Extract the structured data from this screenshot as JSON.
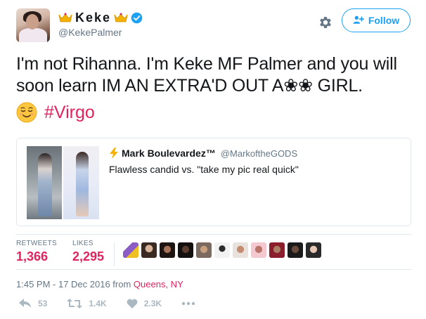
{
  "author": {
    "display_name": "Keke",
    "handle": "@KekePalmer",
    "verified": true,
    "avatar_icon": "profile-photo"
  },
  "follow_button": {
    "label": "Follow",
    "icon": "add-user-icon"
  },
  "settings_icon": "gear-icon",
  "tweet": {
    "text": "I'm not Rihanna. I'm Keke MF Palmer and you will soon learn IM AN EXTRA'D OUT A❀❀ GIRL.",
    "emoji": "relieved-face",
    "hashtag": "#Virgo"
  },
  "quoted_tweet": {
    "name": "Mark Boulevardez™",
    "handle": "@MarkoftheGODS",
    "text": "Flawless candid vs. \"take my pic real quick\""
  },
  "stats": {
    "retweets_label": "RETWEETS",
    "retweets_value": "1,366",
    "likes_label": "LIKES",
    "likes_value": "2,295"
  },
  "timestamp": {
    "time_date": "1:45 PM - 17 Dec 2016 from ",
    "location": "Queens, NY"
  },
  "actions": {
    "reply_count": "53",
    "retweet_count": "1.4K",
    "like_count": "2.3K"
  },
  "colors": {
    "accent": "#1da1f2",
    "highlight": "#e0245e",
    "muted": "#657786"
  }
}
